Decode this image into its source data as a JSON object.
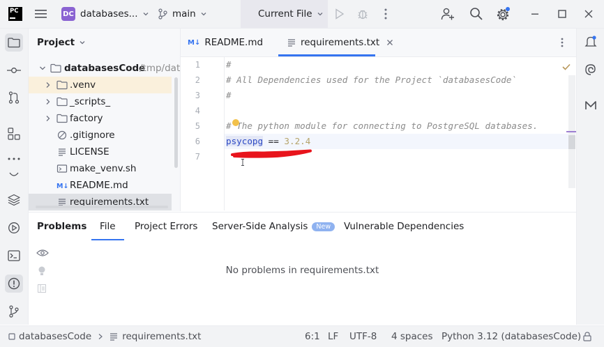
{
  "titlebar": {
    "app_logo": "PC",
    "project_initials": "DC",
    "project_name": "databases...",
    "branch": "main",
    "run_config": "Current File"
  },
  "project_panel": {
    "title": "Project",
    "root": {
      "name": "databasesCode",
      "path": "/tmp/data"
    },
    "items": [
      {
        "label": ".venv",
        "icon": "folder-icon",
        "expandable": true
      },
      {
        "label": "_scripts_",
        "icon": "folder-icon",
        "expandable": true
      },
      {
        "label": "factory",
        "icon": "folder-icon",
        "expandable": true
      },
      {
        "label": ".gitignore",
        "icon": "ignore-file-icon",
        "expandable": false
      },
      {
        "label": "LICENSE",
        "icon": "text-file-icon",
        "expandable": false
      },
      {
        "label": "make_venv.sh",
        "icon": "shell-file-icon",
        "expandable": false
      },
      {
        "label": "README.md",
        "icon": "markdown-file-icon",
        "expandable": false
      },
      {
        "label": "requirements.txt",
        "icon": "text-file-icon",
        "expandable": false
      }
    ]
  },
  "editor": {
    "tabs": [
      {
        "label": "README.md",
        "icon_text": "M↓"
      },
      {
        "label": "requirements.txt",
        "active": true
      }
    ],
    "line_numbers": [
      "1",
      "2",
      "3",
      "4",
      "5",
      "6",
      "7"
    ],
    "lines": [
      {
        "text": "#"
      },
      {
        "text": "# All Dependencies used for the Project `databasesCode`"
      },
      {
        "text": "#"
      },
      {
        "text": ""
      },
      {
        "text": "# The python module for connecting to PostgreSQL databases."
      },
      {
        "pkg": "psycopg",
        "op": " == ",
        "ver": "3.2.4"
      },
      {
        "text": ""
      }
    ]
  },
  "problems_panel": {
    "tabs": [
      {
        "label": "Problems",
        "bold": true
      },
      {
        "label": "File",
        "active": true
      },
      {
        "label": "Project Errors"
      },
      {
        "label": "Server-Side Analysis",
        "badge": "New"
      },
      {
        "label": "Vulnerable Dependencies"
      }
    ],
    "empty_message": "No problems in requirements.txt"
  },
  "statusbar": {
    "breadcrumb_project": "databasesCode",
    "breadcrumb_file": "requirements.txt",
    "position": "6:1",
    "line_ending": "LF",
    "encoding": "UTF-8",
    "indent": "4 spaces",
    "interpreter": "Python 3.12 (databasesCode)"
  },
  "colors": {
    "accent": "#3574f0",
    "project_badge": "#8a63d2",
    "folder_highlight": "#faf0dc",
    "annotation_red": "#e8141c"
  }
}
